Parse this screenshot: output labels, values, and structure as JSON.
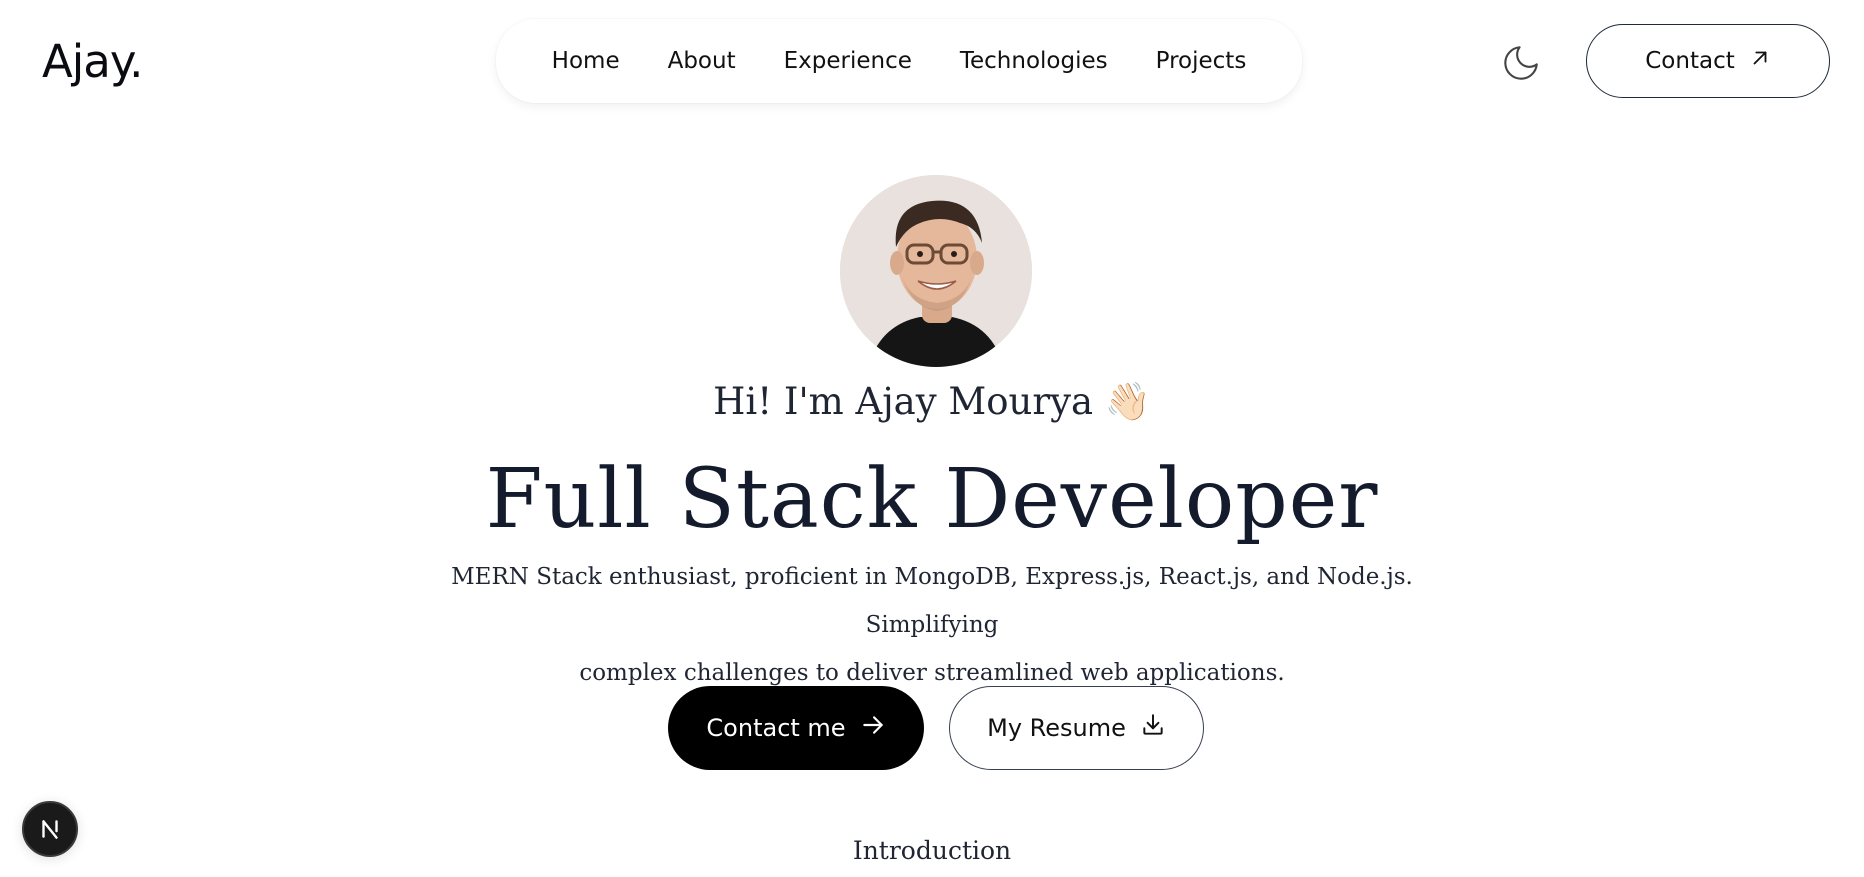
{
  "header": {
    "logo": "Ajay.",
    "nav": [
      "Home",
      "About",
      "Experience",
      "Technologies",
      "Projects"
    ],
    "theme_icon": "moon-icon",
    "contact_label": "Contact",
    "contact_icon": "arrow-up-right-icon"
  },
  "hero": {
    "greeting": "Hi! I'm Ajay Mourya",
    "greeting_emoji": "👋🏻",
    "title": "Full Stack Developer",
    "description_line1": "MERN Stack enthusiast, proficient in MongoDB, Express.js, React.js, and Node.js. Simplifying",
    "description_line2": "complex challenges to deliver streamlined web applications.",
    "primary_label": "Contact me",
    "primary_icon": "arrow-right-icon",
    "secondary_label": "My Resume",
    "secondary_icon": "download-icon"
  },
  "intro": {
    "heading": "Introduction"
  },
  "badge": {
    "letter": "N"
  },
  "colors": {
    "primary_button": "#000000",
    "text": "#141b2d"
  }
}
